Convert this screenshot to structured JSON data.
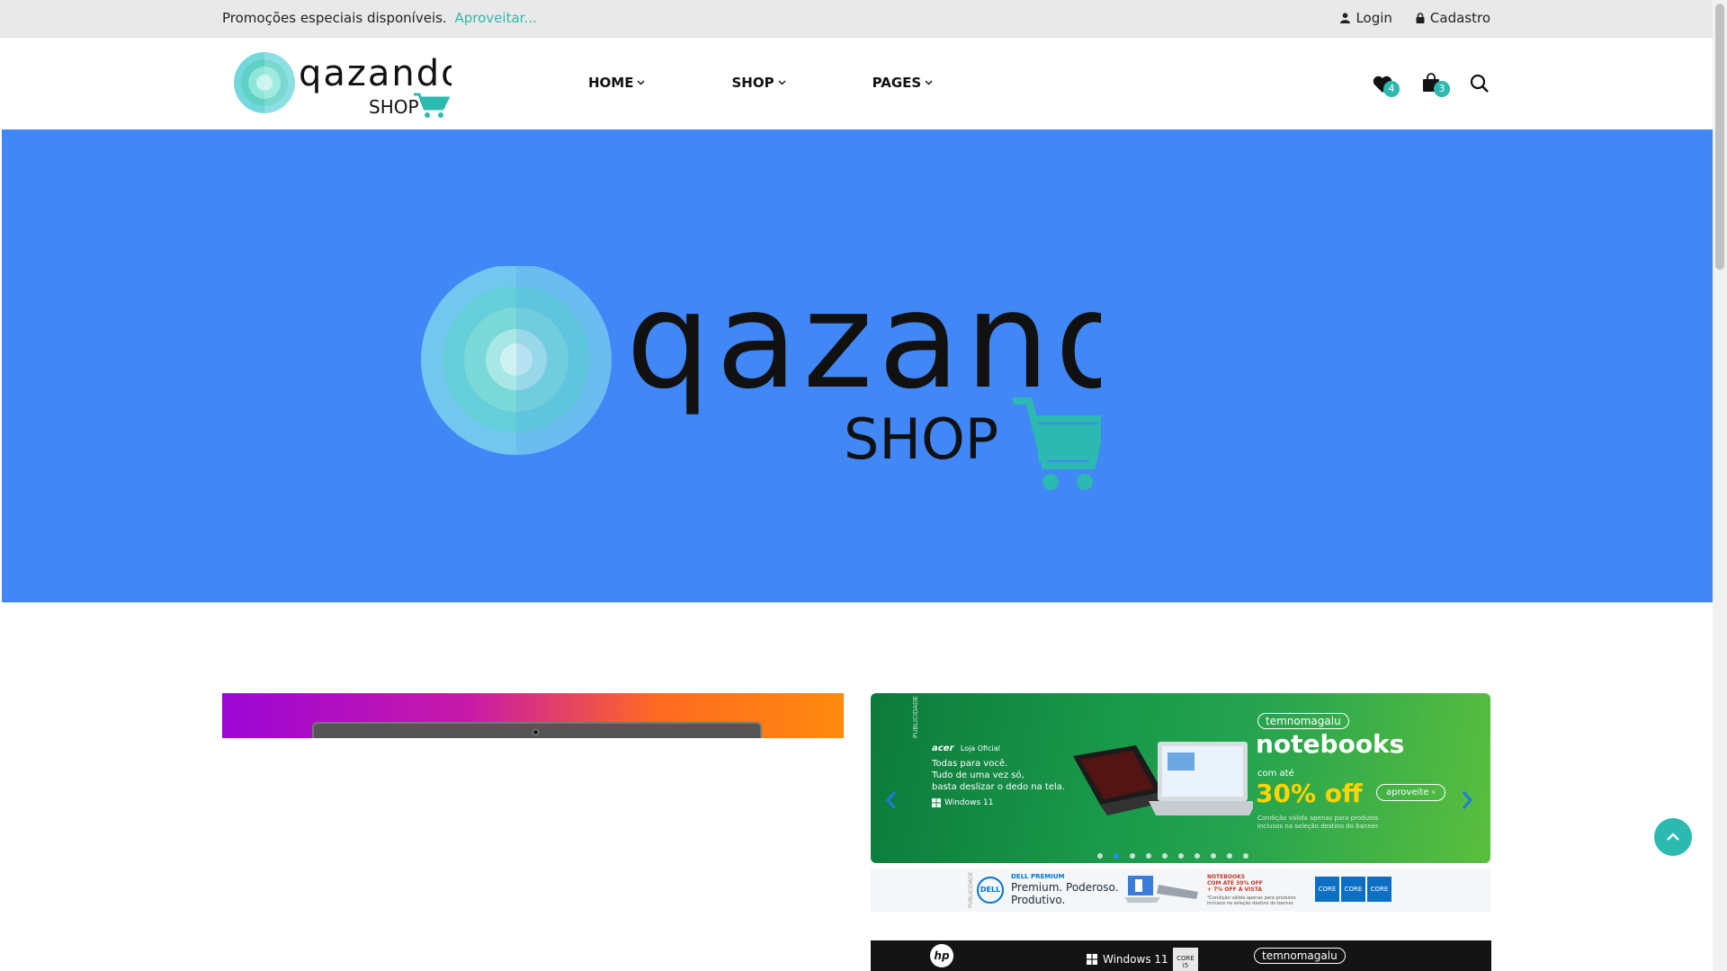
{
  "topbar": {
    "promo_text": "Promoções especiais disponíveis.",
    "promo_link": "Aproveitar...",
    "login_label": "Login",
    "signup_label": "Cadastro"
  },
  "header": {
    "logo_word": "qazando",
    "logo_sub": "SHOP",
    "nav": [
      {
        "label": "HOME"
      },
      {
        "label": "SHOP"
      },
      {
        "label": "PAGES"
      }
    ],
    "wishlist_count": "4",
    "cart_count": "3",
    "accent_color": "#2bb9b0"
  },
  "hero": {
    "background_color": "#4187f6",
    "logo_word": "qazando",
    "logo_sub": "SHOP"
  },
  "carousel": {
    "side_tag": "PUBLICIDADE",
    "brand": "acer",
    "brand_store": "Loja Oficial",
    "desc_lines": [
      "Todas para você.",
      "Tudo de uma vez só,",
      "basta deslizar o dedo na tela."
    ],
    "windows_label": "Windows 11",
    "store_badge": "temnomagalu",
    "headline": "notebooks",
    "prefix": "com até",
    "discount": "30% off",
    "cta": "aproveite ›",
    "fine_print": "Condição válida apenas para produtos inclusos na seleção destino do banner.",
    "slide_count": 10,
    "active_slide": 2
  },
  "dell_banner": {
    "side_tag": "PUBLICIDADE",
    "logo": "DELL",
    "premium": "DELL PREMIUM",
    "tagline_1": "Premium. Poderoso.",
    "tagline_2": "Produtivo.",
    "notebooks_line_1": "NOTEBOOKS",
    "notebooks_line_2": "COM ATÉ 30% OFF",
    "notebooks_line_3": "+ 7% OFF À VISTA",
    "fine_print": "*Condição válida apenas para produtos inclusos na seleção destino do banner.",
    "chip_label": "CORE"
  },
  "hp_banner": {
    "logo": "hp",
    "windows_label": "Windows 11",
    "intel_label": "CORE i5",
    "store_badge": "temnomagalu"
  }
}
